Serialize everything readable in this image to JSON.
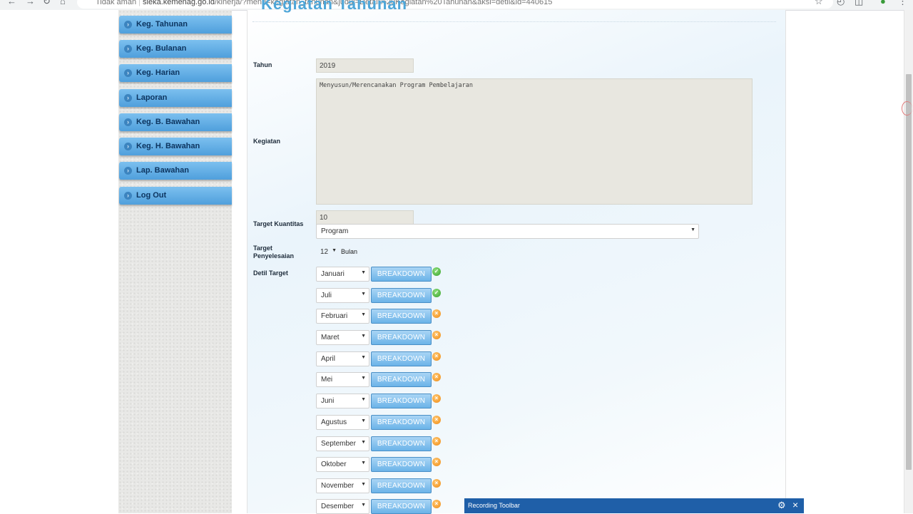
{
  "browser": {
    "security_label": "Tidak aman",
    "url_host": "sieka.kemenag.go.id",
    "url_path": "/kinerja/?menu=kegiatan_tahunan&judul=Detail%20Kegiatan%20Tahunan&aksi=detil&id=440615"
  },
  "sidebar": {
    "items": [
      {
        "label": "Keg. Tahunan"
      },
      {
        "label": "Keg. Bulanan"
      },
      {
        "label": "Keg. Harian"
      },
      {
        "label": "Laporan"
      },
      {
        "label": "Keg. B. Bawahan"
      },
      {
        "label": "Keg. H. Bawahan"
      },
      {
        "label": "Lap. Bawahan"
      },
      {
        "label": "Log Out"
      }
    ]
  },
  "form": {
    "title": "Kegiatan Tahunan",
    "tahun_label": "Tahun",
    "tahun_value": "2019",
    "kegiatan_label": "Kegiatan",
    "kegiatan_value": "Menyusun/Merencanakan Program Pembelajaran",
    "target_kuantitas_label": "Target Kuantitas",
    "target_kuantitas_value": "10",
    "satuan_value": "Program",
    "target_penyelesaian_label_1": "Target",
    "target_penyelesaian_label_2": "Penyelesaian",
    "penyelesaian_value": "12",
    "penyelesaian_unit": "Bulan",
    "detil_target_label": "Detil Target",
    "breakdown_label": "BREAKDOWN",
    "months": [
      {
        "name": "Januari",
        "status": "done"
      },
      {
        "name": "Juli",
        "status": "done"
      },
      {
        "name": "Februari",
        "status": "pending"
      },
      {
        "name": "Maret",
        "status": "pending"
      },
      {
        "name": "April",
        "status": "pending"
      },
      {
        "name": "Mei",
        "status": "pending"
      },
      {
        "name": "Juni",
        "status": "pending"
      },
      {
        "name": "Agustus",
        "status": "pending"
      },
      {
        "name": "September",
        "status": "pending"
      },
      {
        "name": "Oktober",
        "status": "pending"
      },
      {
        "name": "November",
        "status": "pending"
      },
      {
        "name": "Desember",
        "status": "pending"
      }
    ]
  },
  "recording_toolbar": {
    "title": "Recording Toolbar"
  },
  "colors": {
    "menu_accent": "#4f9fdc",
    "status_done": "#37a12a",
    "status_pending": "#f08a12",
    "toolbar_bg": "#1f5fa8"
  }
}
